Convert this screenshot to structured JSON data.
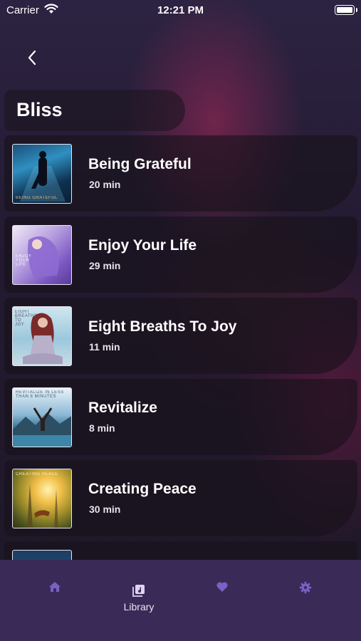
{
  "status_bar": {
    "carrier": "Carrier",
    "time": "12:21 PM"
  },
  "header": {
    "title": "Bliss"
  },
  "sessions": [
    {
      "title": "Being Grateful",
      "duration": "20 min",
      "thumb_caption": "BEING GRATEFUL"
    },
    {
      "title": "Enjoy Your Life",
      "duration": "29 min",
      "thumb_caption": "ENJOY YOUR LIFE"
    },
    {
      "title": "Eight Breaths To Joy",
      "duration": "11 min",
      "thumb_caption": "EIGHT BREATHS TO JOY"
    },
    {
      "title": "Revitalize",
      "duration": "8 min",
      "thumb_caption": "REVITALIZE IN LESS THAN 8 MINUTES"
    },
    {
      "title": "Creating Peace",
      "duration": "30 min",
      "thumb_caption": "CREATING PEACE"
    },
    {
      "title": "",
      "duration": "",
      "thumb_caption": ""
    }
  ],
  "tab_bar": {
    "items": [
      {
        "icon": "home-icon",
        "label": ""
      },
      {
        "icon": "library-icon",
        "label": "Library"
      },
      {
        "icon": "heart-icon",
        "label": ""
      },
      {
        "icon": "gear-icon",
        "label": ""
      }
    ]
  },
  "colors": {
    "tab_bar_bg": "#3a2a58",
    "tab_icon": "#7b5fc4"
  }
}
